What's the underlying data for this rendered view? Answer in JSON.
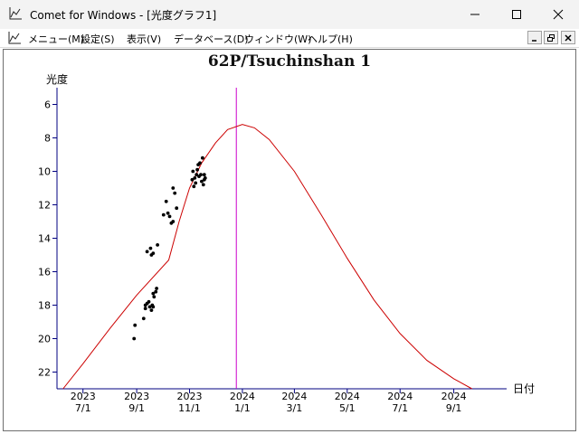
{
  "window": {
    "title": "Comet for Windows - [光度グラフ1]",
    "icon": "chart-app-icon",
    "controls": [
      "minimize-icon",
      "maximize-icon",
      "close-icon"
    ]
  },
  "menu": {
    "items": [
      "メニュー(M)",
      "設定(S)",
      "表示(V)",
      "データベース(D)",
      "ウィンドウ(W)",
      "ヘルプ(H)"
    ],
    "mdi_controls": [
      "mdi-minimize-icon",
      "mdi-restore-icon",
      "mdi-close-icon"
    ]
  },
  "colors": {
    "curve": "#cc0000",
    "axis": "#000080",
    "marker": "#cc00cc",
    "points": "#000000"
  },
  "chart_data": {
    "type": "scatter",
    "title": "62P/Tsuchinshan 1",
    "ylabel": "光度",
    "xlabel": "日付",
    "y_inverted": true,
    "ylim": [
      23,
      5
    ],
    "yticks": [
      6,
      8,
      10,
      12,
      14,
      16,
      18,
      20,
      22
    ],
    "x_domain": [
      "2023-06-01",
      "2024-11-01"
    ],
    "xticks": [
      {
        "date": "2023-07-01",
        "label1": "2023",
        "label2": "7/1"
      },
      {
        "date": "2023-09-01",
        "label1": "2023",
        "label2": "9/1"
      },
      {
        "date": "2023-11-01",
        "label1": "2023",
        "label2": "11/1"
      },
      {
        "date": "2024-01-01",
        "label1": "2024",
        "label2": "1/1"
      },
      {
        "date": "2024-03-01",
        "label1": "2024",
        "label2": "3/1"
      },
      {
        "date": "2024-05-01",
        "label1": "2024",
        "label2": "5/1"
      },
      {
        "date": "2024-07-01",
        "label1": "2024",
        "label2": "7/1"
      },
      {
        "date": "2024-09-01",
        "label1": "2024",
        "label2": "9/1"
      }
    ],
    "marker_date": "2023-12-25",
    "curve": [
      {
        "date": "2023-06-08",
        "mag": 23.0
      },
      {
        "date": "2023-07-01",
        "mag": 21.5
      },
      {
        "date": "2023-08-01",
        "mag": 19.4
      },
      {
        "date": "2023-09-01",
        "mag": 17.4
      },
      {
        "date": "2023-10-08",
        "mag": 15.3
      },
      {
        "date": "2023-10-20",
        "mag": 13.0
      },
      {
        "date": "2023-11-01",
        "mag": 11.0
      },
      {
        "date": "2023-11-15",
        "mag": 9.5
      },
      {
        "date": "2023-12-01",
        "mag": 8.3
      },
      {
        "date": "2023-12-15",
        "mag": 7.5
      },
      {
        "date": "2024-01-01",
        "mag": 7.2
      },
      {
        "date": "2024-01-15",
        "mag": 7.4
      },
      {
        "date": "2024-02-01",
        "mag": 8.1
      },
      {
        "date": "2024-03-01",
        "mag": 10.0
      },
      {
        "date": "2024-04-01",
        "mag": 12.6
      },
      {
        "date": "2024-05-01",
        "mag": 15.2
      },
      {
        "date": "2024-06-01",
        "mag": 17.7
      },
      {
        "date": "2024-07-01",
        "mag": 19.7
      },
      {
        "date": "2024-08-01",
        "mag": 21.3
      },
      {
        "date": "2024-09-01",
        "mag": 22.4
      },
      {
        "date": "2024-09-22",
        "mag": 23.0
      }
    ],
    "observations": [
      {
        "date": "2023-08-29",
        "mag": 20.0
      },
      {
        "date": "2023-08-30",
        "mag": 19.2
      },
      {
        "date": "2023-09-09",
        "mag": 18.8
      },
      {
        "date": "2023-09-11",
        "mag": 18.2
      },
      {
        "date": "2023-09-11",
        "mag": 18.0
      },
      {
        "date": "2023-09-13",
        "mag": 17.9
      },
      {
        "date": "2023-09-15",
        "mag": 17.8
      },
      {
        "date": "2023-09-16",
        "mag": 18.1
      },
      {
        "date": "2023-09-18",
        "mag": 18.3
      },
      {
        "date": "2023-09-19",
        "mag": 18.0
      },
      {
        "date": "2023-09-20",
        "mag": 18.1
      },
      {
        "date": "2023-09-20",
        "mag": 17.3
      },
      {
        "date": "2023-09-21",
        "mag": 17.5
      },
      {
        "date": "2023-09-23",
        "mag": 17.2
      },
      {
        "date": "2023-09-24",
        "mag": 17.0
      },
      {
        "date": "2023-09-13",
        "mag": 14.8
      },
      {
        "date": "2023-09-17",
        "mag": 14.6
      },
      {
        "date": "2023-09-18",
        "mag": 15.0
      },
      {
        "date": "2023-09-20",
        "mag": 14.9
      },
      {
        "date": "2023-09-25",
        "mag": 14.4
      },
      {
        "date": "2023-10-02",
        "mag": 12.6
      },
      {
        "date": "2023-10-05",
        "mag": 11.8
      },
      {
        "date": "2023-10-07",
        "mag": 12.5
      },
      {
        "date": "2023-10-09",
        "mag": 12.7
      },
      {
        "date": "2023-10-11",
        "mag": 13.1
      },
      {
        "date": "2023-10-13",
        "mag": 13.0
      },
      {
        "date": "2023-10-13",
        "mag": 11.0
      },
      {
        "date": "2023-10-15",
        "mag": 11.3
      },
      {
        "date": "2023-10-17",
        "mag": 12.2
      },
      {
        "date": "2023-11-04",
        "mag": 10.5
      },
      {
        "date": "2023-11-05",
        "mag": 10.0
      },
      {
        "date": "2023-11-06",
        "mag": 10.9
      },
      {
        "date": "2023-11-07",
        "mag": 10.4
      },
      {
        "date": "2023-11-08",
        "mag": 10.7
      },
      {
        "date": "2023-11-09",
        "mag": 10.2
      },
      {
        "date": "2023-11-10",
        "mag": 9.9
      },
      {
        "date": "2023-11-11",
        "mag": 9.6
      },
      {
        "date": "2023-11-12",
        "mag": 10.3
      },
      {
        "date": "2023-11-13",
        "mag": 9.5
      },
      {
        "date": "2023-11-14",
        "mag": 10.2
      },
      {
        "date": "2023-11-15",
        "mag": 10.6
      },
      {
        "date": "2023-11-16",
        "mag": 9.2
      },
      {
        "date": "2023-11-17",
        "mag": 10.8
      },
      {
        "date": "2023-11-18",
        "mag": 10.5
      },
      {
        "date": "2023-11-18",
        "mag": 10.2
      },
      {
        "date": "2023-11-19",
        "mag": 10.4
      }
    ]
  }
}
